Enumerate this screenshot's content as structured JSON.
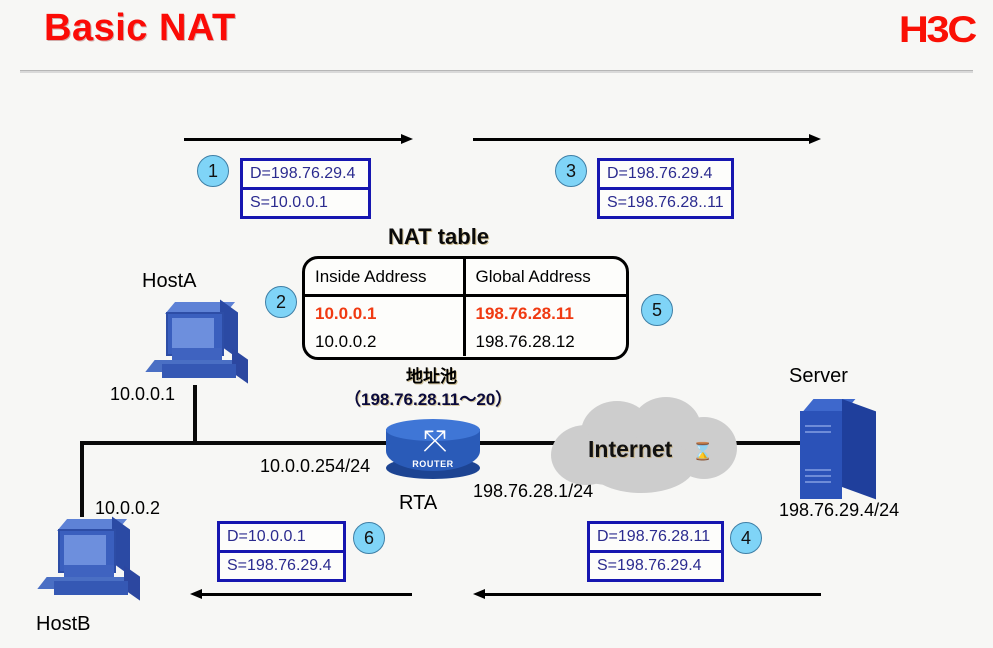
{
  "header": {
    "title": "Basic NAT",
    "brand": "H3C"
  },
  "packets": [
    {
      "id": "packet-1",
      "step": "1",
      "dest": "D=198.76.29.4",
      "src": "S=10.0.0.1"
    },
    {
      "id": "packet-3",
      "step": "3",
      "dest": "D=198.76.29.4",
      "src": "S=198.76.28..11"
    },
    {
      "id": "packet-6",
      "step": "6",
      "dest": "D=10.0.0.1",
      "src": "S=198.76.29.4"
    },
    {
      "id": "packet-4",
      "step": "4",
      "dest": "D=198.76.28.11",
      "src": "S=198.76.29.4"
    }
  ],
  "steps": {
    "s1": "1",
    "s2": "2",
    "s3": "3",
    "s4": "4",
    "s5": "5",
    "s6": "6"
  },
  "nat": {
    "title": "NAT table",
    "columns": [
      "Inside Address",
      "Global Address"
    ],
    "rows": [
      {
        "inside": "10.0.0.1",
        "global": "198.76.28.11",
        "highlight": true
      },
      {
        "inside": "10.0.0.2",
        "global": "198.76.28.12",
        "highlight": false
      }
    ],
    "pool_label": "地址池",
    "pool_range": "（198.76.28.11～20）",
    "highlight_color": "#f03a12"
  },
  "topology": {
    "hostA_name": "HostA",
    "hostA_ip": "10.0.0.1",
    "hostB_name": "HostB",
    "hostB_ip": "10.0.0.2",
    "router_name": "RTA",
    "router_inside_ip": "10.0.0.254/24",
    "router_outside_ip": "198.76.28.1/24",
    "cloud_label": "Internet",
    "server_name": "Server",
    "server_ip": "198.76.29.4/24",
    "router_glyph": "⤧",
    "router_tag": "ROUTER",
    "cursor_icon": "hourglass-cursor",
    "cursor_glyph": "⌛"
  }
}
